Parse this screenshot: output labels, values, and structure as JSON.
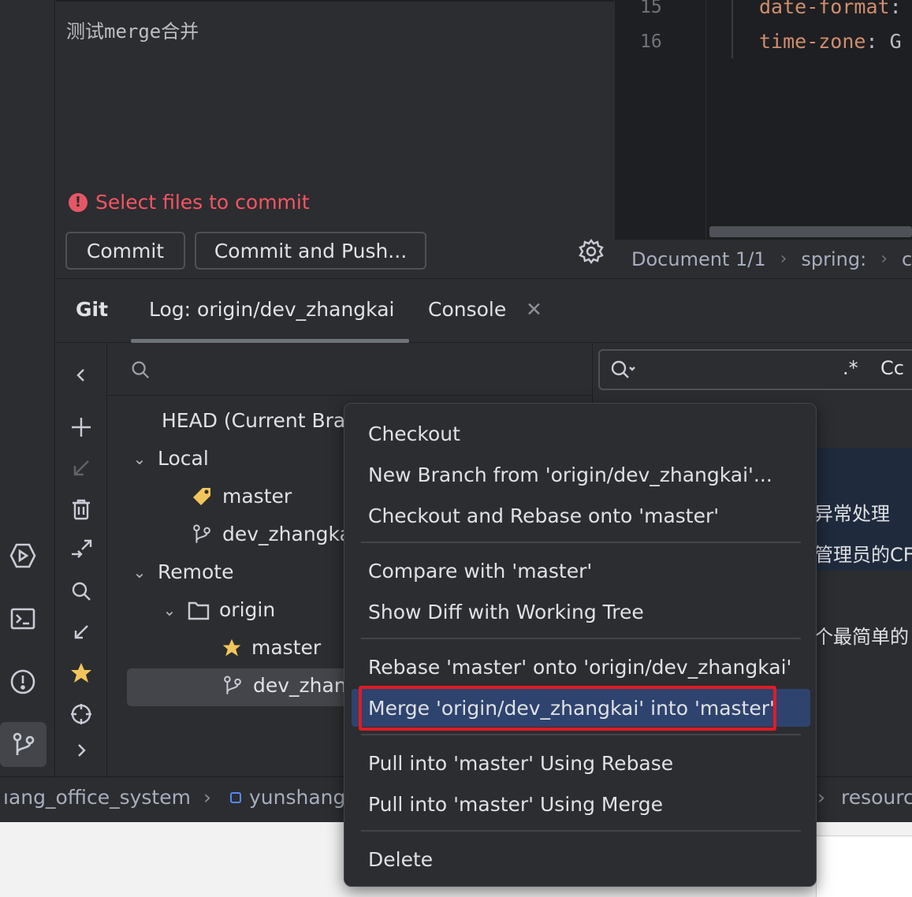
{
  "commit": {
    "message": "测试merge合并",
    "warning": "Select files to commit",
    "commit_label": "Commit",
    "commit_push_label": "Commit and Push..."
  },
  "editor": {
    "lines": [
      {
        "number": "15",
        "key": "date-format",
        "rest": ":"
      },
      {
        "number": "16",
        "key": "time-zone",
        "rest": ": G"
      }
    ],
    "breadcrumb": [
      "Document 1/1",
      "spring:",
      "c"
    ]
  },
  "git": {
    "tabs": [
      "Git",
      "Log: origin/dev_zhangkai",
      "Console"
    ],
    "branch_tree": {
      "head": "HEAD (Current Bra",
      "local_label": "Local",
      "local_branches": [
        "master",
        "dev_zhangka"
      ],
      "remote_label": "Remote",
      "remote_name": "origin",
      "remote_branches": [
        "master",
        "dev_zhan"
      ]
    },
    "log_search_regex": ".*",
    "log_search_case": "Cc",
    "log_snippets": [
      "异常处理",
      "管理员的CF",
      "个最简单的"
    ]
  },
  "status_bar": {
    "project": "ıang_office_system",
    "module": "yunshang",
    "tail": "resourc"
  },
  "context_menu": {
    "groups": [
      [
        "Checkout",
        "New Branch from 'origin/dev_zhangkai'...",
        "Checkout and Rebase onto 'master'"
      ],
      [
        "Compare with 'master'",
        "Show Diff with Working Tree"
      ],
      [
        "Rebase 'master' onto 'origin/dev_zhangkai'",
        "Merge 'origin/dev_zhangkai' into 'master'"
      ],
      [
        "Pull into 'master' Using Rebase",
        "Pull into 'master' Using Merge"
      ],
      [
        "Delete"
      ]
    ],
    "selected": "Merge 'origin/dev_zhangkai' into 'master'"
  },
  "icons": {
    "left_strip": [
      "run-icon",
      "terminal-icon",
      "problems-icon",
      "git-branch-icon"
    ],
    "toolbar": [
      "chevron-left-icon",
      "plus-icon",
      "checkout-arrow-icon",
      "trash-icon",
      "fetch-icon",
      "search-icon",
      "update-icon",
      "star-icon",
      "locate-icon",
      "chevron-right-icon"
    ]
  },
  "colors": {
    "accent_selected": "#2e436e",
    "highlight_outline": "#e01b24",
    "error_text": "#f75464",
    "favorite_star": "#f2c55c"
  }
}
